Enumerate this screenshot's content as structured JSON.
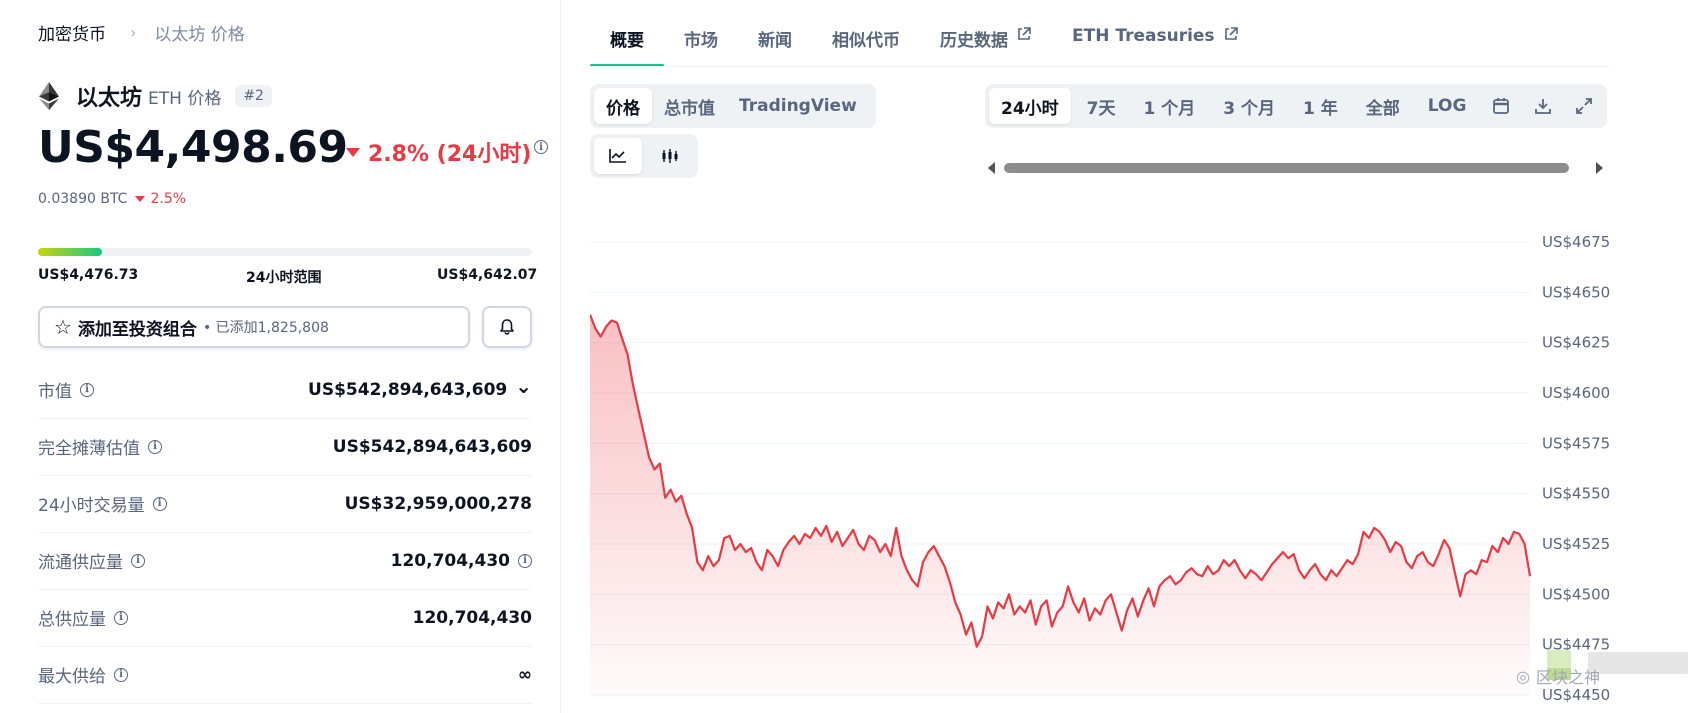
{
  "breadcrumb": {
    "root": "加密货币",
    "current": "以太坊 价格"
  },
  "coin": {
    "name": "以太坊",
    "symbol_label": "ETH 价格",
    "rank": "#2"
  },
  "price": {
    "value": "US$4,498.69",
    "change": "2.8% (24小时)",
    "btc_value": "0.03890 BTC",
    "btc_change": "2.5%"
  },
  "range_24h": {
    "low": "US$4,476.73",
    "label": "24小时范围",
    "high": "US$4,642.07",
    "position_fraction": 0.13
  },
  "portfolio": {
    "label": "添加至投资组合",
    "added": "• 已添加1,825,808"
  },
  "stats": [
    {
      "label": "市值",
      "value": "US$542,894,643,609",
      "info": true,
      "chevron": true
    },
    {
      "label": "完全摊薄估值",
      "value": "US$542,894,643,609",
      "info": true
    },
    {
      "label": "24小时交易量",
      "value": "US$32,959,000,278",
      "info": true
    },
    {
      "label": "流通供应量",
      "value": "120,704,430",
      "info": true,
      "value_info": true
    },
    {
      "label": "总供应量",
      "value": "120,704,430",
      "info": true
    },
    {
      "label": "最大供给",
      "value": "∞",
      "info": true
    }
  ],
  "tabs": [
    {
      "label": "概要",
      "active": true
    },
    {
      "label": "市场"
    },
    {
      "label": "新闻"
    },
    {
      "label": "相似代币"
    },
    {
      "label": "历史数据",
      "external": true
    },
    {
      "label": "ETH Treasuries",
      "external": true
    }
  ],
  "view_toggle": [
    "价格",
    "总市值",
    "TradingView"
  ],
  "range_toggle": [
    "24小时",
    "7天",
    "1 个月",
    "3 个月",
    "1 年",
    "全部",
    "LOG"
  ],
  "range_icons": [
    "calendar-icon",
    "download-icon",
    "fullscreen-icon"
  ],
  "chart_data": {
    "type": "area",
    "y_ticks": [
      "US$4675",
      "US$4650",
      "US$4625",
      "US$4600",
      "US$4575",
      "US$4550",
      "US$4525",
      "US$4500",
      "US$4475",
      "US$4450"
    ],
    "ylim": [
      4450,
      4675
    ],
    "grid": true,
    "color": "#ea3943",
    "series": [
      {
        "values": [
          4639,
          4632,
          4628,
          4633,
          4636,
          4635,
          4627,
          4619,
          4604,
          4592,
          4580,
          4568,
          4562,
          4565,
          4548,
          4552,
          4546,
          4549,
          4540,
          4533,
          4516,
          4512,
          4519,
          4514,
          4517,
          4528,
          4529,
          4522,
          4525,
          4521,
          4523,
          4516,
          4512,
          4522,
          4519,
          4514,
          4522,
          4526,
          4529,
          4525,
          4530,
          4528,
          4533,
          4529,
          4534,
          4526,
          4531,
          4524,
          4528,
          4532,
          4525,
          4522,
          4529,
          4527,
          4521,
          4525,
          4519,
          4533,
          4519,
          4512,
          4507,
          4504,
          4516,
          4521,
          4524,
          4519,
          4514,
          4506,
          4496,
          4490,
          4480,
          4486,
          4474,
          4479,
          4494,
          4488,
          4496,
          4493,
          4500,
          4490,
          4494,
          4491,
          4497,
          4485,
          4494,
          4497,
          4484,
          4491,
          4494,
          4504,
          4496,
          4491,
          4498,
          4487,
          4493,
          4490,
          4497,
          4500,
          4491,
          4482,
          4492,
          4498,
          4489,
          4497,
          4503,
          4494,
          4504,
          4507,
          4509,
          4505,
          4507,
          4511,
          4513,
          4510,
          4509,
          4514,
          4510,
          4512,
          4517,
          4514,
          4517,
          4512,
          4508,
          4512,
          4510,
          4507,
          4511,
          4515,
          4518,
          4521,
          4518,
          4520,
          4512,
          4508,
          4512,
          4515,
          4510,
          4507,
          4512,
          4509,
          4513,
          4517,
          4515,
          4520,
          4531,
          4528,
          4533,
          4531,
          4527,
          4521,
          4526,
          4524,
          4516,
          4513,
          4519,
          4521,
          4516,
          4514,
          4520,
          4527,
          4523,
          4511,
          4499,
          4510,
          4512,
          4510,
          4517,
          4516,
          4524,
          4521,
          4528,
          4525,
          4531,
          4530,
          4525,
          4509
        ]
      }
    ]
  },
  "watermark": "区块之神"
}
